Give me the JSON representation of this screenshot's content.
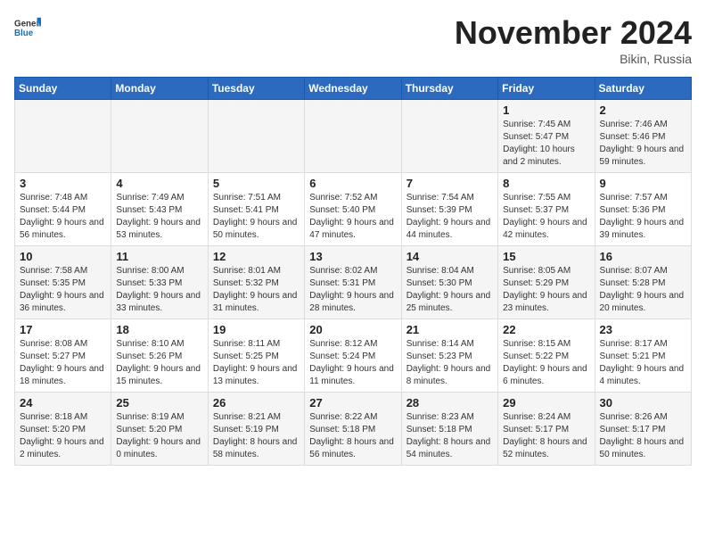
{
  "header": {
    "logo_general": "General",
    "logo_blue": "Blue",
    "month_title": "November 2024",
    "location": "Bikin, Russia"
  },
  "weekdays": [
    "Sunday",
    "Monday",
    "Tuesday",
    "Wednesday",
    "Thursday",
    "Friday",
    "Saturday"
  ],
  "weeks": [
    [
      {
        "day": "",
        "info": ""
      },
      {
        "day": "",
        "info": ""
      },
      {
        "day": "",
        "info": ""
      },
      {
        "day": "",
        "info": ""
      },
      {
        "day": "",
        "info": ""
      },
      {
        "day": "1",
        "info": "Sunrise: 7:45 AM\nSunset: 5:47 PM\nDaylight: 10 hours and 2 minutes."
      },
      {
        "day": "2",
        "info": "Sunrise: 7:46 AM\nSunset: 5:46 PM\nDaylight: 9 hours and 59 minutes."
      }
    ],
    [
      {
        "day": "3",
        "info": "Sunrise: 7:48 AM\nSunset: 5:44 PM\nDaylight: 9 hours and 56 minutes."
      },
      {
        "day": "4",
        "info": "Sunrise: 7:49 AM\nSunset: 5:43 PM\nDaylight: 9 hours and 53 minutes."
      },
      {
        "day": "5",
        "info": "Sunrise: 7:51 AM\nSunset: 5:41 PM\nDaylight: 9 hours and 50 minutes."
      },
      {
        "day": "6",
        "info": "Sunrise: 7:52 AM\nSunset: 5:40 PM\nDaylight: 9 hours and 47 minutes."
      },
      {
        "day": "7",
        "info": "Sunrise: 7:54 AM\nSunset: 5:39 PM\nDaylight: 9 hours and 44 minutes."
      },
      {
        "day": "8",
        "info": "Sunrise: 7:55 AM\nSunset: 5:37 PM\nDaylight: 9 hours and 42 minutes."
      },
      {
        "day": "9",
        "info": "Sunrise: 7:57 AM\nSunset: 5:36 PM\nDaylight: 9 hours and 39 minutes."
      }
    ],
    [
      {
        "day": "10",
        "info": "Sunrise: 7:58 AM\nSunset: 5:35 PM\nDaylight: 9 hours and 36 minutes."
      },
      {
        "day": "11",
        "info": "Sunrise: 8:00 AM\nSunset: 5:33 PM\nDaylight: 9 hours and 33 minutes."
      },
      {
        "day": "12",
        "info": "Sunrise: 8:01 AM\nSunset: 5:32 PM\nDaylight: 9 hours and 31 minutes."
      },
      {
        "day": "13",
        "info": "Sunrise: 8:02 AM\nSunset: 5:31 PM\nDaylight: 9 hours and 28 minutes."
      },
      {
        "day": "14",
        "info": "Sunrise: 8:04 AM\nSunset: 5:30 PM\nDaylight: 9 hours and 25 minutes."
      },
      {
        "day": "15",
        "info": "Sunrise: 8:05 AM\nSunset: 5:29 PM\nDaylight: 9 hours and 23 minutes."
      },
      {
        "day": "16",
        "info": "Sunrise: 8:07 AM\nSunset: 5:28 PM\nDaylight: 9 hours and 20 minutes."
      }
    ],
    [
      {
        "day": "17",
        "info": "Sunrise: 8:08 AM\nSunset: 5:27 PM\nDaylight: 9 hours and 18 minutes."
      },
      {
        "day": "18",
        "info": "Sunrise: 8:10 AM\nSunset: 5:26 PM\nDaylight: 9 hours and 15 minutes."
      },
      {
        "day": "19",
        "info": "Sunrise: 8:11 AM\nSunset: 5:25 PM\nDaylight: 9 hours and 13 minutes."
      },
      {
        "day": "20",
        "info": "Sunrise: 8:12 AM\nSunset: 5:24 PM\nDaylight: 9 hours and 11 minutes."
      },
      {
        "day": "21",
        "info": "Sunrise: 8:14 AM\nSunset: 5:23 PM\nDaylight: 9 hours and 8 minutes."
      },
      {
        "day": "22",
        "info": "Sunrise: 8:15 AM\nSunset: 5:22 PM\nDaylight: 9 hours and 6 minutes."
      },
      {
        "day": "23",
        "info": "Sunrise: 8:17 AM\nSunset: 5:21 PM\nDaylight: 9 hours and 4 minutes."
      }
    ],
    [
      {
        "day": "24",
        "info": "Sunrise: 8:18 AM\nSunset: 5:20 PM\nDaylight: 9 hours and 2 minutes."
      },
      {
        "day": "25",
        "info": "Sunrise: 8:19 AM\nSunset: 5:20 PM\nDaylight: 9 hours and 0 minutes."
      },
      {
        "day": "26",
        "info": "Sunrise: 8:21 AM\nSunset: 5:19 PM\nDaylight: 8 hours and 58 minutes."
      },
      {
        "day": "27",
        "info": "Sunrise: 8:22 AM\nSunset: 5:18 PM\nDaylight: 8 hours and 56 minutes."
      },
      {
        "day": "28",
        "info": "Sunrise: 8:23 AM\nSunset: 5:18 PM\nDaylight: 8 hours and 54 minutes."
      },
      {
        "day": "29",
        "info": "Sunrise: 8:24 AM\nSunset: 5:17 PM\nDaylight: 8 hours and 52 minutes."
      },
      {
        "day": "30",
        "info": "Sunrise: 8:26 AM\nSunset: 5:17 PM\nDaylight: 8 hours and 50 minutes."
      }
    ]
  ]
}
